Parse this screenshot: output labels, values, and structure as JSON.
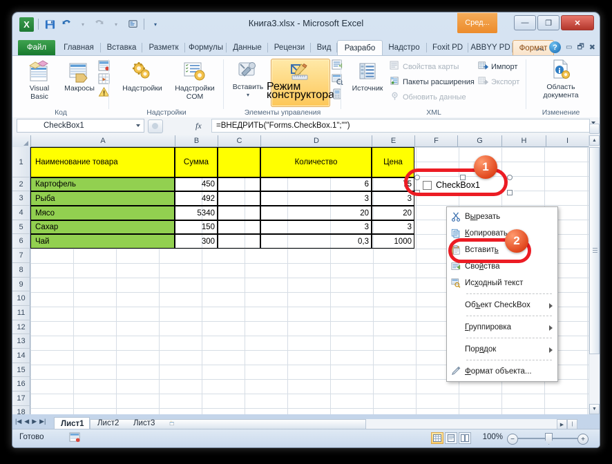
{
  "window": {
    "title": "Книга3.xlsx  -  Microsoft Excel",
    "format_context_tab": "Сред...",
    "minimize": "—",
    "restore": "❐",
    "close": "✕"
  },
  "quick_access": {
    "logo": "X",
    "save_icon": "save-icon",
    "undo_icon": "undo-icon",
    "redo_icon": "redo-icon",
    "quickprint_icon": "quick-print-icon",
    "customize_icon": "customize-icon"
  },
  "ribbon_tabs": [
    {
      "label": "Файл",
      "kind": "file"
    },
    {
      "label": "Главная",
      "kind": "normal"
    },
    {
      "label": "Вставка",
      "kind": "normal"
    },
    {
      "label": "Разметк",
      "kind": "normal"
    },
    {
      "label": "Формулы",
      "kind": "normal"
    },
    {
      "label": "Данные",
      "kind": "normal"
    },
    {
      "label": "Рецензи",
      "kind": "normal"
    },
    {
      "label": "Вид",
      "kind": "normal"
    },
    {
      "label": "Разрабо",
      "kind": "active"
    },
    {
      "label": "Надстро",
      "kind": "normal"
    },
    {
      "label": "Foxit PD",
      "kind": "normal"
    },
    {
      "label": "ABBYY PD",
      "kind": "normal"
    },
    {
      "label": "Формат",
      "kind": "format"
    }
  ],
  "ribbon": {
    "groups": [
      {
        "label": "Код"
      },
      {
        "label": "Надстройки"
      },
      {
        "label": "Элементы управления"
      },
      {
        "label": "XML"
      },
      {
        "label": "Изменение"
      }
    ],
    "buttons": {
      "visual_basic": "Visual\nBasic",
      "visual_basic_l1": "Visual",
      "visual_basic_l2": "Basic",
      "macros": "Макросы",
      "addins": "Надстройки",
      "com_addins_l1": "Надстройки",
      "com_addins_l2": "COM",
      "insert_l1": "Вставить",
      "design_mode_l1": "Режим",
      "design_mode_l2": "конструктора",
      "source_l1": "Источник",
      "map_properties": "Свойства карты",
      "expansion_packs": "Пакеты расширения",
      "refresh_data": "Обновить данные",
      "import": "Импорт",
      "export": "Экспорт",
      "document_panel_l1": "Область",
      "document_panel_l2": "документа"
    }
  },
  "formula_bar": {
    "name_box": "CheckBox1",
    "fx_label": "fx",
    "formula": "=ВНЕДРИТЬ(\"Forms.CheckBox.1\";\"\")"
  },
  "grid": {
    "columns": [
      "A",
      "B",
      "C",
      "D",
      "E",
      "F",
      "G",
      "H",
      "I"
    ],
    "rows": [
      "1",
      "2",
      "3",
      "4",
      "5",
      "6",
      "7",
      "8",
      "9",
      "10",
      "11",
      "12",
      "13",
      "14",
      "15",
      "16",
      "17",
      "18"
    ],
    "header_row": {
      "A": "Наименование товара",
      "B": "Сумма",
      "C": "",
      "D": "Количество",
      "E": "Цена"
    },
    "data_rows": [
      {
        "row": "2",
        "name": "Картофель",
        "summa": "450",
        "c": "",
        "kolichestvo": "6",
        "cena": "75"
      },
      {
        "row": "3",
        "name": "Рыба",
        "summa": "492",
        "c": "",
        "kolichestvo": "3",
        "cena": "3"
      },
      {
        "row": "4",
        "name": "Мясо",
        "summa": "5340",
        "c": "",
        "kolichestvo": "20",
        "cena": "20"
      },
      {
        "row": "5",
        "name": "Сахар",
        "summa": "150",
        "c": "",
        "kolichestvo": "3",
        "cena": "3"
      },
      {
        "row": "6",
        "name": "Чай",
        "summa": "300",
        "c": "",
        "kolichestvo": "0,3",
        "cena": "1000"
      }
    ]
  },
  "checkbox_control": {
    "label": "CheckBox1",
    "checked": false
  },
  "context_menu": {
    "items": [
      {
        "label": "Вырезать",
        "icon": "cut-icon",
        "submenu": false
      },
      {
        "label": "Копировать",
        "icon": "copy-icon",
        "submenu": false
      },
      {
        "label": "Вставить",
        "icon": "paste-icon",
        "submenu": false
      },
      {
        "label": "Свойства",
        "icon": "properties-icon",
        "submenu": false
      },
      {
        "label": "Исходный текст",
        "icon": "source-code-icon",
        "submenu": false
      },
      {
        "label": "Объект CheckBox",
        "icon": "",
        "submenu": true
      },
      {
        "label": "Группировка",
        "icon": "",
        "submenu": true
      },
      {
        "label": "Порядок",
        "icon": "",
        "submenu": true
      },
      {
        "label": "Формат объекта...",
        "icon": "format-object-icon",
        "submenu": false
      }
    ]
  },
  "annotations": [
    {
      "badge": "1",
      "target": "checkbox-control"
    },
    {
      "badge": "2",
      "target": "context-menu-properties"
    }
  ],
  "sheet_tabs": [
    {
      "label": "Лист1",
      "active": true
    },
    {
      "label": "Лист2",
      "active": false
    },
    {
      "label": "Лист3",
      "active": false
    }
  ],
  "status_bar": {
    "state": "Готово",
    "zoom": "100%",
    "zoom_out": "−",
    "zoom_in": "+"
  },
  "colors": {
    "header_yellow": "#ffff00",
    "name_green": "#92d050",
    "annotation_red": "#ec1c24",
    "badge_orange": "#e0461c",
    "excel_green": "#177a2e"
  }
}
